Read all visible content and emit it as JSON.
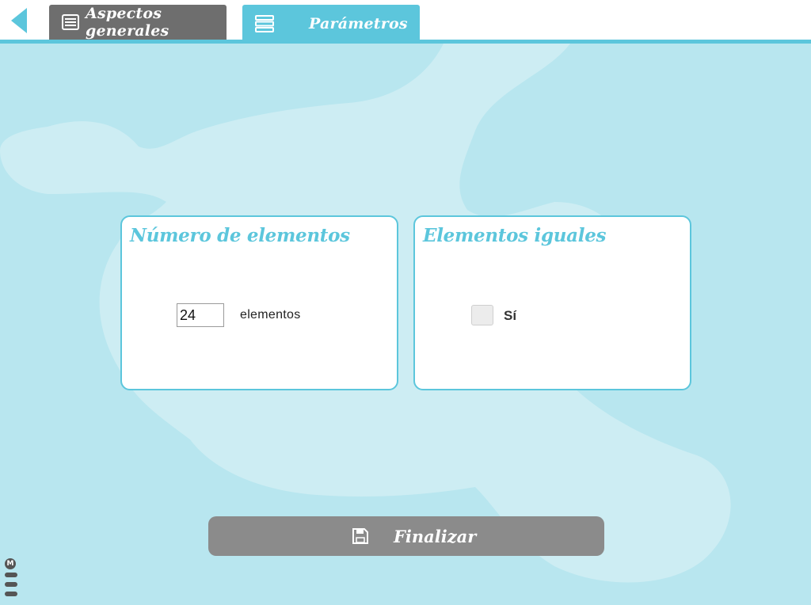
{
  "tabs": [
    {
      "label": "Aspectos generales",
      "icon": "list-icon",
      "active": false
    },
    {
      "label": "Parámetros",
      "icon": "rows-icon",
      "active": true
    }
  ],
  "cards": {
    "count": {
      "title": "Número de elementos",
      "value": "24",
      "suffix": "elementos"
    },
    "equal": {
      "title": "Elementos iguales",
      "checkbox_label": "Sí",
      "checked": false
    }
  },
  "footer": {
    "finish_label": "Finalizar",
    "finish_icon": "save-icon",
    "menu_badge": "M"
  },
  "colors": {
    "accent": "#5cc6dc",
    "background": "#b8e6ef",
    "tab_inactive": "#6e6e6e",
    "button": "#8b8b8b"
  }
}
